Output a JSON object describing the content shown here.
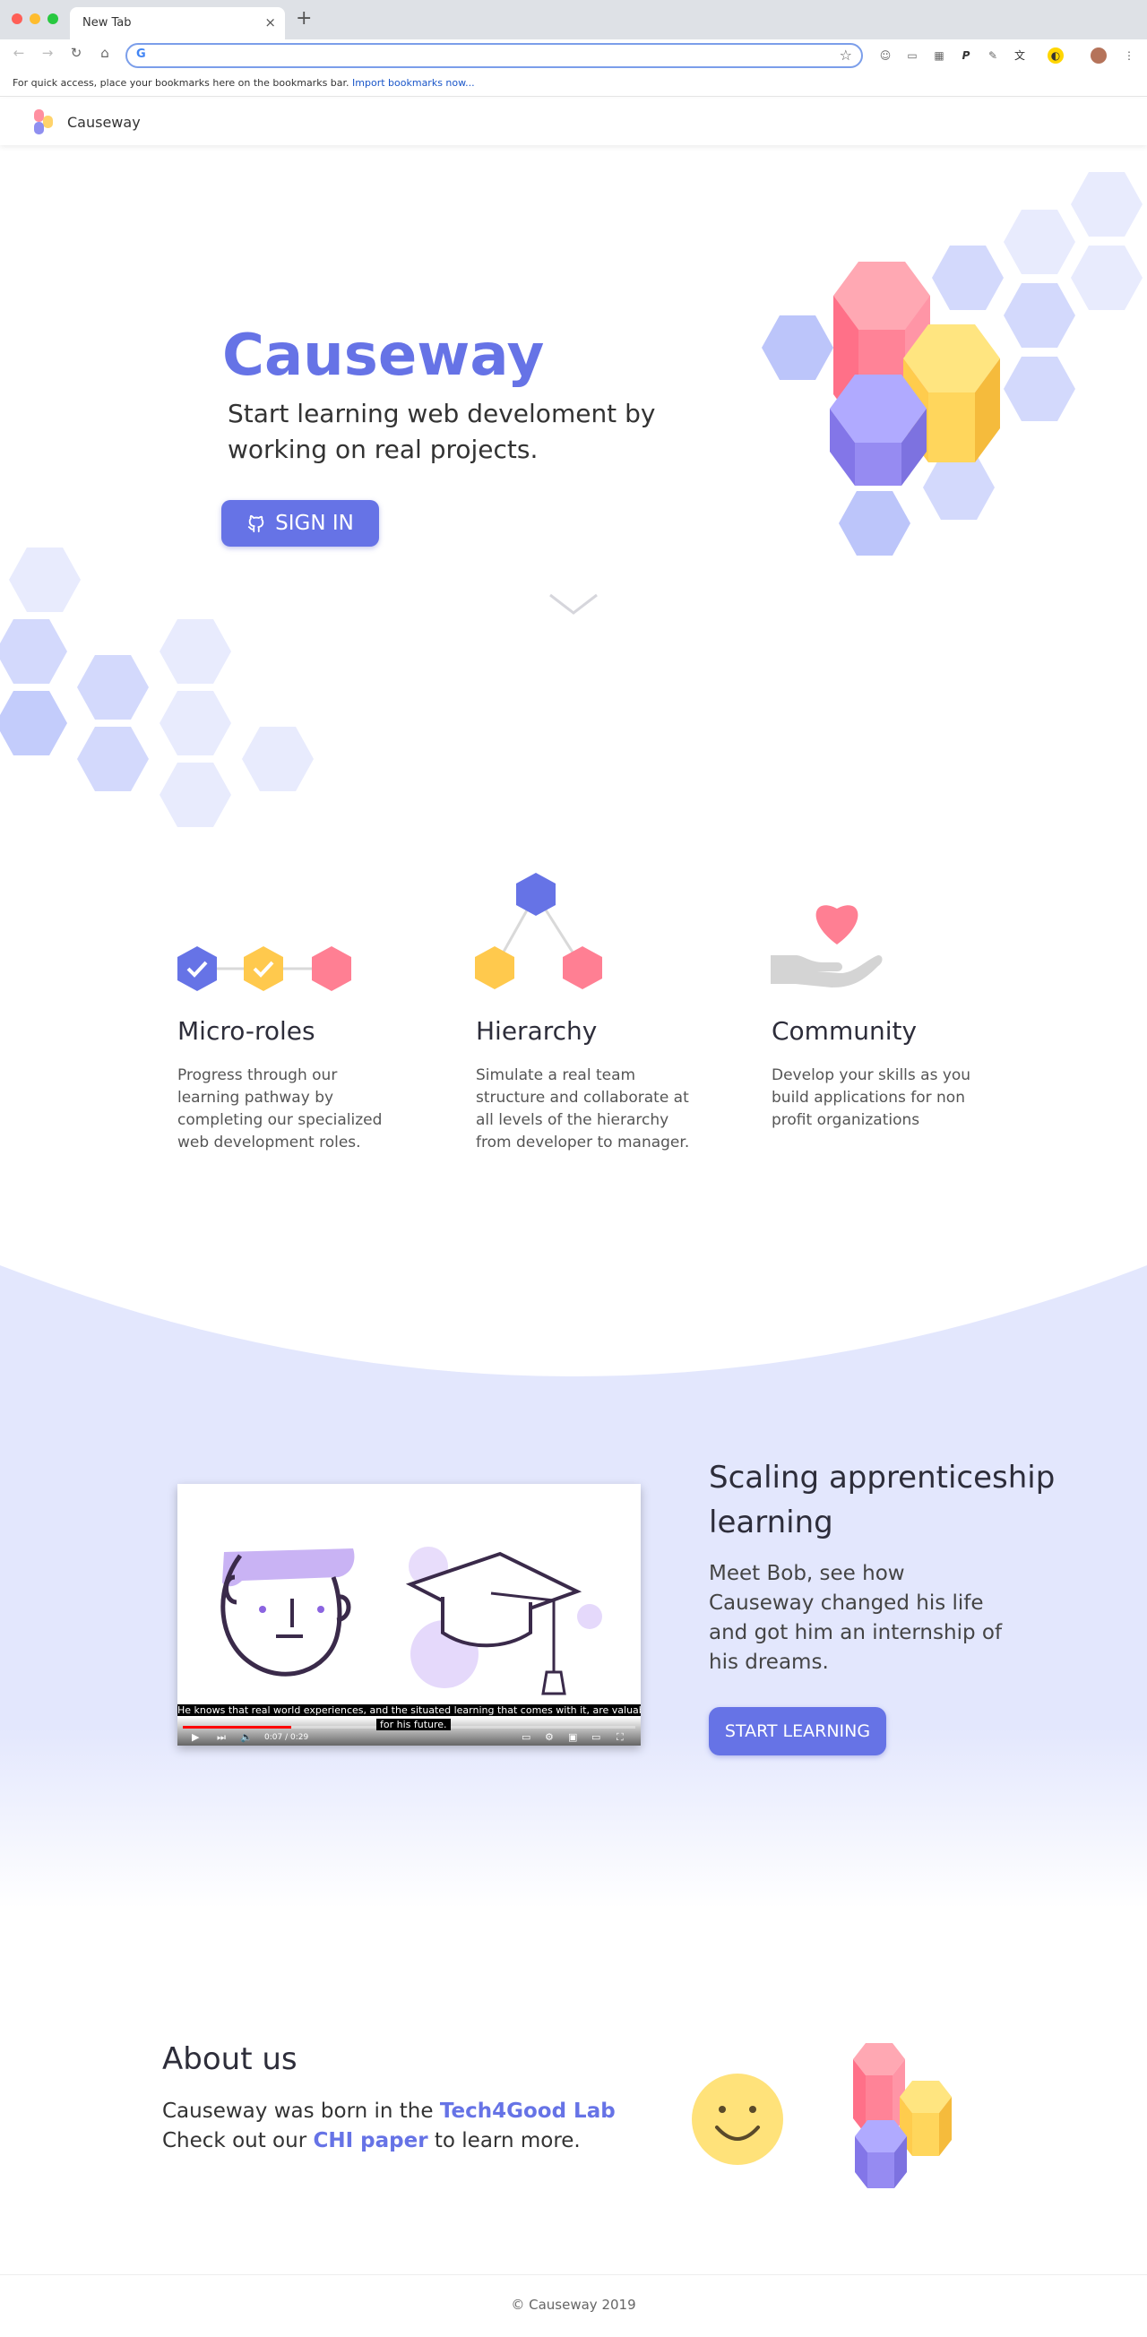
{
  "browser": {
    "tab_title": "New Tab",
    "tab_close": "×",
    "new_tab": "+",
    "back": "←",
    "forward": "→",
    "reload": "↻",
    "home": "⌂",
    "omnibox_value": "",
    "bookmarks_text": "For quick access, place your bookmarks here on the bookmarks bar.",
    "bookmarks_link": "Import bookmarks now..."
  },
  "header": {
    "brand": "Causeway"
  },
  "hero": {
    "title": "Causeway",
    "subtitle": "Start learning web develoment by working on real projects.",
    "signin_label": "SIGN IN"
  },
  "features": [
    {
      "title": "Micro-roles",
      "description": "Progress through our learning pathway by completing our specialized web development roles."
    },
    {
      "title": "Hierarchy",
      "description": "Simulate a real team structure and collaborate at all levels of the hierarchy from developer to manager."
    },
    {
      "title": "Community",
      "description": "Develop your skills as you build applications for non profit organizations"
    }
  ],
  "video": {
    "caption_line1": "He knows that real world experiences, and the situated learning that comes with it, are valuable",
    "caption_line2": "for his future.",
    "time": "0:07 / 0:29",
    "progress": 0.24
  },
  "scaling": {
    "title": "Scaling apprenticeship learning",
    "description": "Meet Bob, see how Causeway changed his life and got him an internship of his dreams.",
    "button_label": "START LEARNING"
  },
  "about": {
    "title": "About us",
    "line1_prefix": "Causeway was born in the ",
    "line1_link": "Tech4Good Lab",
    "line2_prefix": "Check out our ",
    "line2_link": "CHI paper",
    "line2_suffix": " to learn more."
  },
  "footer": {
    "copyright": "© Causeway 2019"
  },
  "colors": {
    "accent": "#6673e6",
    "pink": "#ff8fa0",
    "yellow": "#ffd36b",
    "purple": "#8f8ff0",
    "light_blue": "#c8d0fb",
    "section_bg": "#e3e7fd"
  }
}
